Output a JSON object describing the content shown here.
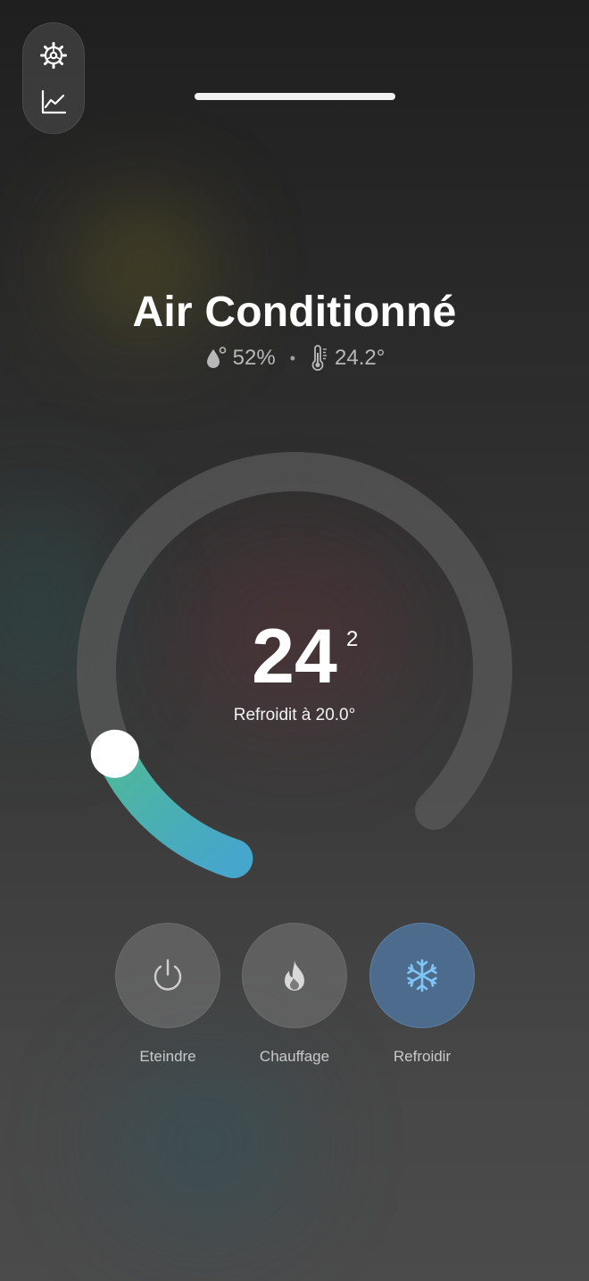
{
  "header": {
    "title": "Air Conditionné",
    "humidity": "52%",
    "separator": "•",
    "current_temp": "24.2°",
    "humidity_icon": "humidity-drop-icon",
    "temperature_icon": "thermometer-icon"
  },
  "side_controls": {
    "settings_icon": "gear-icon",
    "history_icon": "chart-line-icon"
  },
  "thermostat": {
    "target_integer": "24",
    "target_decimal": "2",
    "status_text": "Refroidit à 20.0°",
    "level": 0.12,
    "colors": {
      "track": "#5a5a5a",
      "active_start": "#4fb89a",
      "active_end": "#46a6cc",
      "knob": "#ffffff"
    }
  },
  "modes": [
    {
      "label": "Eteindre",
      "icon": "power-icon",
      "active": false
    },
    {
      "label": "Chauffage",
      "icon": "flame-icon",
      "active": false
    },
    {
      "label": "Refroidir",
      "icon": "snowflake-icon",
      "active": true
    }
  ],
  "colors": {
    "active_mode": "#4d6b8c",
    "snowflake": "#7fc6f5"
  }
}
